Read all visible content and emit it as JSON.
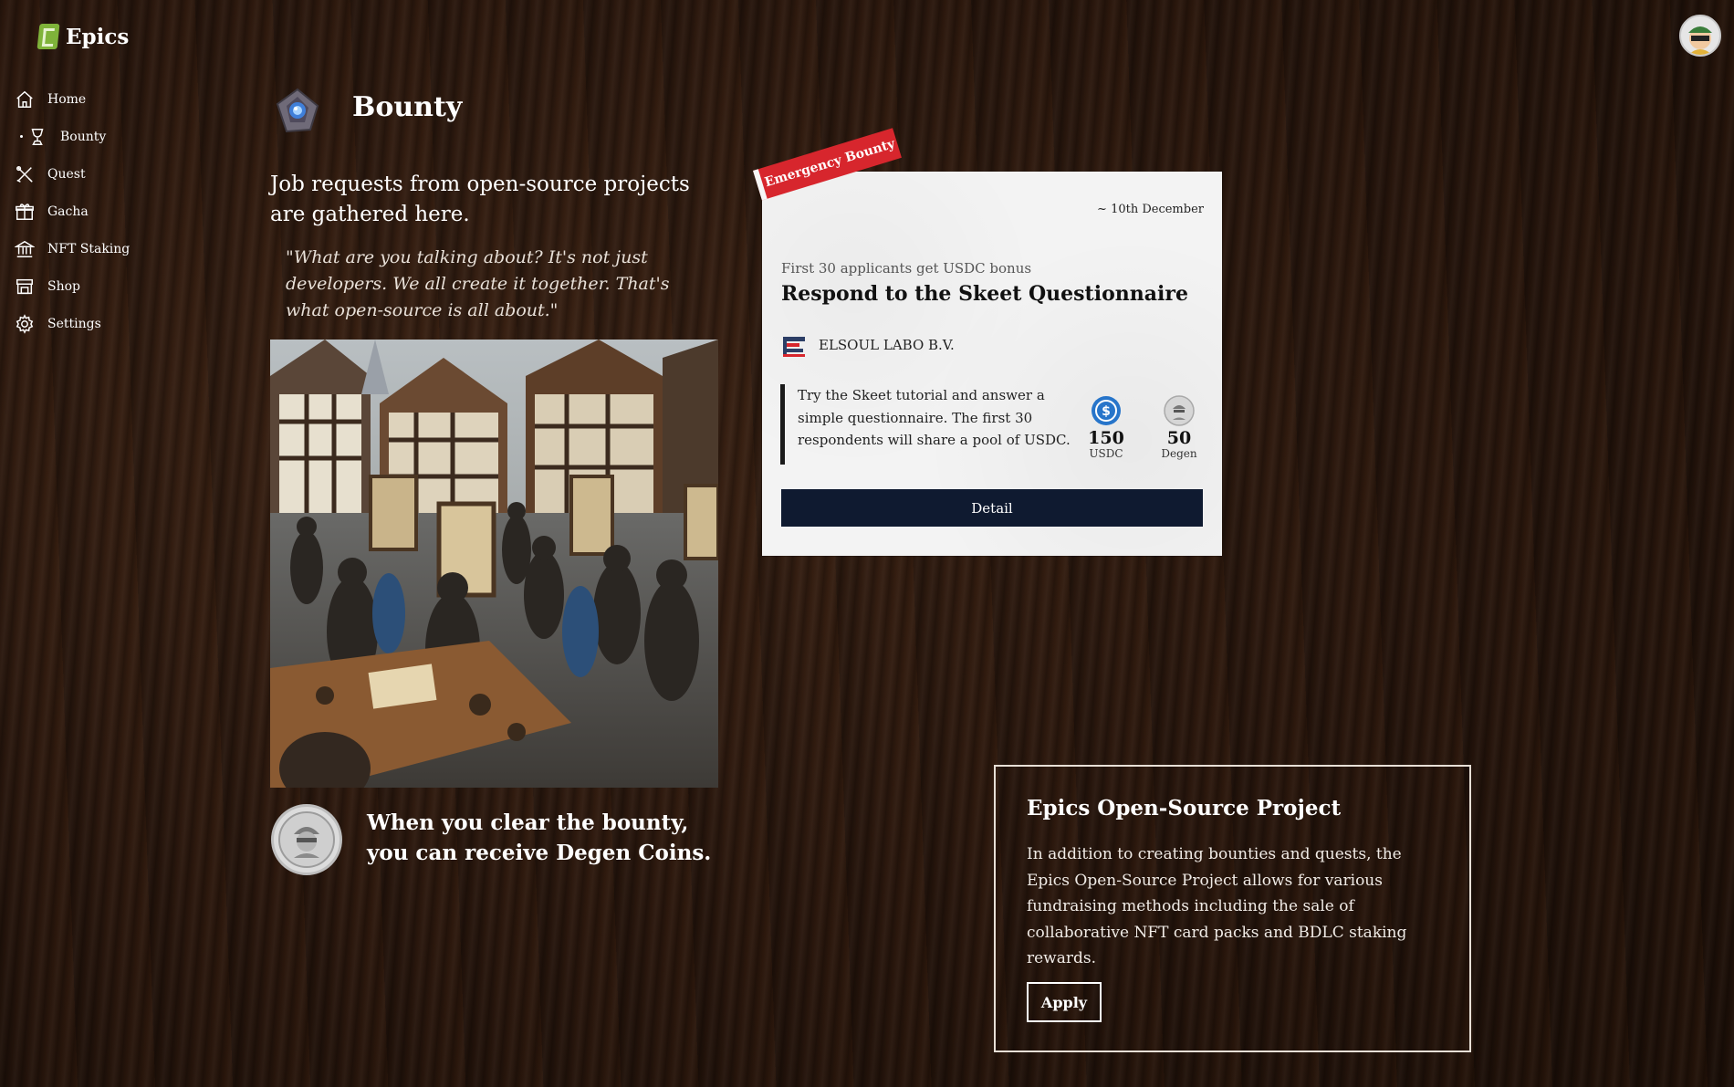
{
  "app": {
    "name": "Epics"
  },
  "sidebar": {
    "items": [
      {
        "label": "Home",
        "icon": "home-icon"
      },
      {
        "label": "Bounty",
        "icon": "trophy-icon",
        "active": true
      },
      {
        "label": "Quest",
        "icon": "tools-icon"
      },
      {
        "label": "Gacha",
        "icon": "gift-icon"
      },
      {
        "label": "NFT Staking",
        "icon": "bank-icon"
      },
      {
        "label": "Shop",
        "icon": "store-icon"
      },
      {
        "label": "Settings",
        "icon": "gear-icon"
      }
    ]
  },
  "header": {
    "title": "Bounty",
    "icon": "crystal-icon"
  },
  "intro": {
    "text": "Job requests from open-source projects are gathered here.",
    "quote": "\"What are you talking about? It's not just developers. We all create it together. That's what open-source is all about.\""
  },
  "hero": {
    "image": "medieval-marketplace-illustration"
  },
  "degen": {
    "text": "When you clear the bounty, you can receive Degen Coins.",
    "icon": "degen-coin-icon"
  },
  "bounty_card": {
    "ribbon": "Emergency Bounty",
    "deadline": "~ 10th December",
    "subtitle": "First 30 applicants get USDC bonus",
    "title": "Respond to the Skeet Questionnaire",
    "organization": "ELSOUL LABO B.V.",
    "description": "Try the Skeet tutorial and answer a simple questionnaire. The first 30 respondents will share a pool of USDC.",
    "rewards": [
      {
        "amount": "150",
        "unit": "USDC",
        "icon": "usdc-icon",
        "color": "#2775ca"
      },
      {
        "amount": "50",
        "unit": "Degen",
        "icon": "degen-coin-icon",
        "color": "#d6d6d6"
      }
    ],
    "detail_label": "Detail"
  },
  "project": {
    "title": "Epics Open-Source Project",
    "text": "In addition to creating bounties and quests, the Epics Open-Source Project allows for various fundraising methods including the sale of collaborative NFT card packs and BDLC staking rewards.",
    "apply_label": "Apply"
  },
  "colors": {
    "accent": "#d7262d",
    "button_dark": "#0f1a30",
    "logo_green": "#7fb33a"
  }
}
